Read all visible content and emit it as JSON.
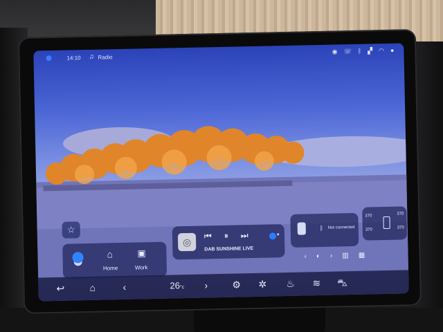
{
  "status_bar": {
    "time": "14:10",
    "source_icon": "music-note-icon",
    "source": "Radio",
    "right_icons": [
      "location-icon",
      "phone-icon",
      "bluetooth-icon",
      "signal-icon",
      "wifi-icon",
      "profile-icon"
    ]
  },
  "navigation": {
    "home_label": "Home",
    "work_label": "Work"
  },
  "media": {
    "station": "DAB SUNSHINE LIVE",
    "prev_icon": "previous-track-icon",
    "pause_icon": "pause-icon",
    "next_icon": "next-track-icon"
  },
  "phone": {
    "status": "Not connected"
  },
  "climate": {
    "left_top": "370",
    "left_bottom": "370",
    "right_top": "370",
    "right_bottom": "370"
  },
  "dock": {
    "temperature": "26",
    "temperature_unit": "°c"
  },
  "colors": {
    "accent": "#2f84ff",
    "card_bg": "#262c64",
    "sky_top": "#2b43b8"
  }
}
